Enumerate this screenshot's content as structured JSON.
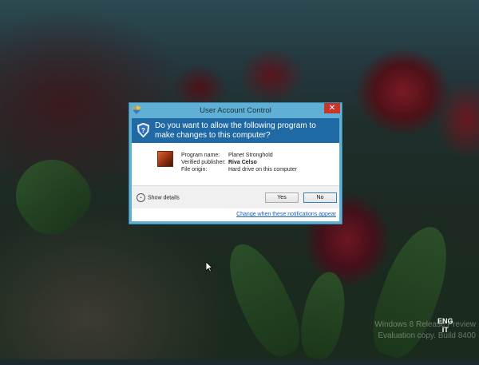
{
  "dialog": {
    "title": "User Account Control",
    "close_symbol": "✕",
    "question": "Do you want to allow the following program to make changes to this computer?",
    "fields": {
      "program_name_label": "Program name:",
      "publisher_label": "Verified publisher:",
      "origin_label": "File origin:",
      "program_name": "Planet Stronghold",
      "publisher": "Riva Celso",
      "origin": "Hard drive on this computer"
    },
    "show_details": "Show details",
    "yes": "Yes",
    "no": "No",
    "change_link": "Change when these notifications appear",
    "icons": [
      "shield-icon",
      "app-icon",
      "chevron-down-icon",
      "close-icon"
    ]
  },
  "taskbar": {
    "lang_primary": "ENG",
    "lang_secondary": "IT"
  },
  "watermark": {
    "line1": "Windows 8 Release Preview",
    "line2": "Evaluation copy. Build 8400"
  },
  "colors": {
    "header_blue": "#1f6aa5",
    "frame_blue": "#5fb0d4",
    "close_red": "#c7362c"
  }
}
